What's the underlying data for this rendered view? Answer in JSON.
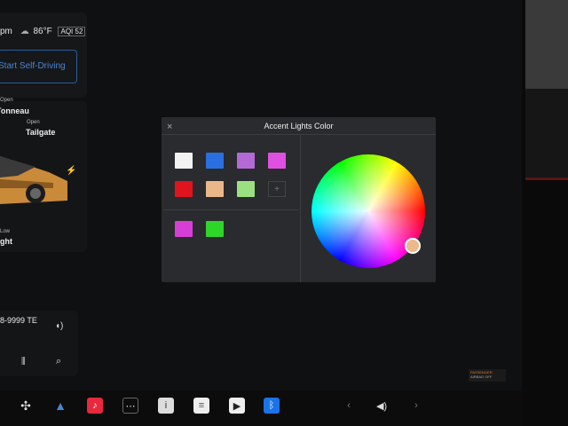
{
  "status": {
    "time_suffix": "pm",
    "temperature": "86°F",
    "aqi_label": "AQI",
    "aqi_value": "52"
  },
  "autopilot": {
    "button_label": "Start Self-Driving"
  },
  "vehicle": {
    "frunk_label_small": "Open",
    "frunk_label": "Tonneau",
    "tailgate_label_small": "Open",
    "tailgate_label": "Tailgate",
    "bottom_small": "Low",
    "bottom_label": "ght"
  },
  "media": {
    "station": "8-9999 TE"
  },
  "dialog": {
    "title": "Accent Lights Color",
    "presets": [
      "#f2f2f2",
      "#2a6fe0",
      "#b46ad6",
      "#e050e0",
      "#e0141e",
      "#eab78a",
      "#9be07e"
    ],
    "custom": [
      "#d63ed6",
      "#2fd62a"
    ],
    "add_symbol": "+",
    "selected_color": "#ebb98a"
  },
  "airbag": {
    "line1": "PASSENGER",
    "line2": "AIRBAG OFF"
  },
  "colors": {
    "accent_blue": "#2a5d9c",
    "dialog_bg": "#2a2b2e"
  }
}
